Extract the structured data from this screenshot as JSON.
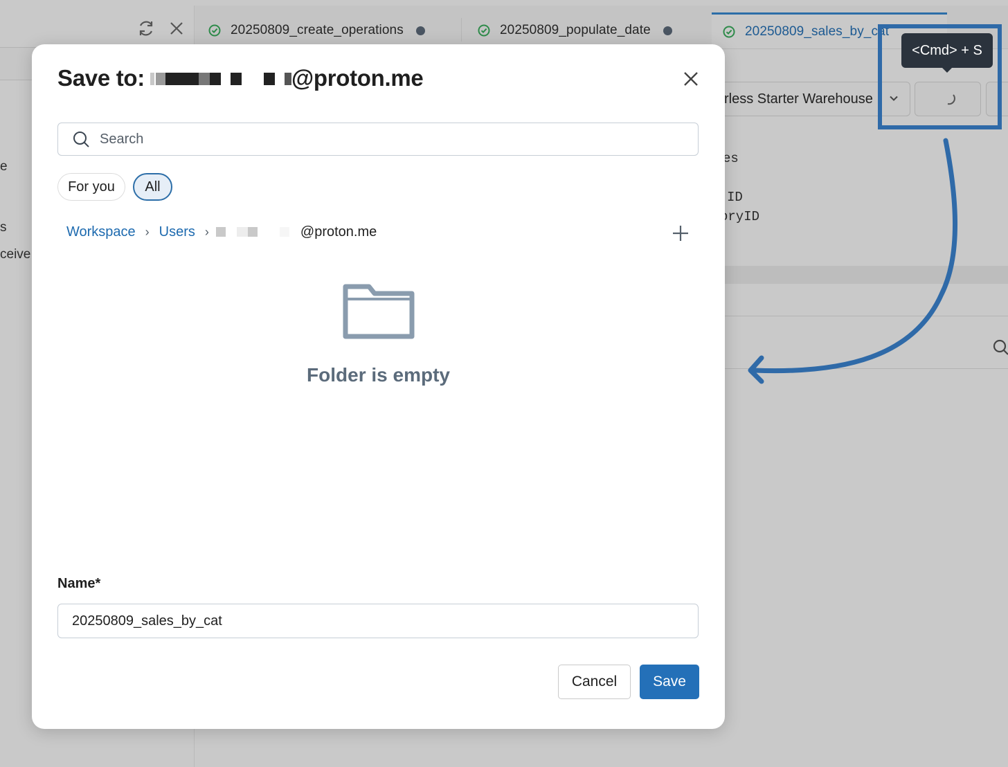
{
  "tabs": [
    {
      "label": "20250809_create_operations"
    },
    {
      "label": "20250809_populate_date"
    },
    {
      "label": "20250809_sales_by_cat"
    }
  ],
  "background": {
    "left_peek": [
      "e",
      "s",
      "ceive"
    ],
    "warehouse_label": "rless Starter Warehouse",
    "code_lines": [
      "es",
      "ID",
      "oryID"
    ]
  },
  "tooltip": {
    "text": "<Cmd> + S"
  },
  "modal": {
    "title_prefix": "Save to:",
    "title_suffix": "@proton.me",
    "search_placeholder": "Search",
    "filters": {
      "for_you": "For you",
      "all": "All"
    },
    "breadcrumb": {
      "workspace": "Workspace",
      "users": "Users",
      "user_suffix": "@proton.me"
    },
    "empty_message": "Folder is empty",
    "name_label": "Name*",
    "name_value": "20250809_sales_by_cat",
    "cancel_label": "Cancel",
    "save_label": "Save"
  },
  "colors": {
    "accent": "#2470b8",
    "link": "#1d6aaf",
    "annotation": "#2f6aa8",
    "success": "#2e8b4a"
  }
}
